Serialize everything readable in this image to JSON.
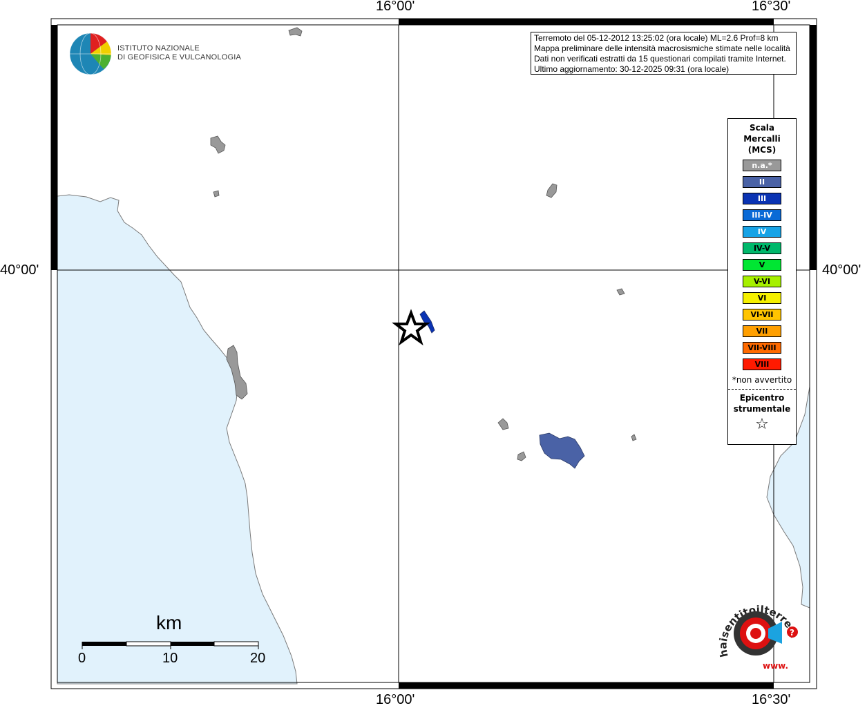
{
  "coords": {
    "top_lon_1": "16°00'",
    "top_lon_2": "16°30'",
    "bottom_lon_1": "16°00'",
    "bottom_lon_2": "16°30'",
    "left_lat": "40°00'",
    "right_lat": "40°00'"
  },
  "logo": {
    "line1": "ISTITUTO NAZIONALE",
    "line2": "DI GEOFISICA E VULCANOLOGIA"
  },
  "info": {
    "line1": "Terremoto del 05-12-2012 13:25:02 (ora locale) ML=2.6 Prof=8 km",
    "line2": "Mappa preliminare delle intensità macrosismiche stimate nelle località",
    "line3": "Dati non verificati estratti da 15 questionari compilati tramite Internet.",
    "line4": "Ultimo aggiornamento: 30-12-2025 09:31 (ora locale)"
  },
  "legend": {
    "title1": "Scala",
    "title2": "Mercalli",
    "title3": "(MCS)",
    "classes": [
      {
        "label": "n.a.*",
        "color": "#999999",
        "text_color": "#ffffff"
      },
      {
        "label": "II",
        "color": "#4a62a6",
        "text_color": "#ffffff"
      },
      {
        "label": "III",
        "color": "#0a33b3",
        "text_color": "#ffffff"
      },
      {
        "label": "III-IV",
        "color": "#0a6ad6",
        "text_color": "#ffffff"
      },
      {
        "label": "IV",
        "color": "#17a3e6",
        "text_color": "#ffffff"
      },
      {
        "label": "IV-V",
        "color": "#00b86b",
        "text_color": "#000000"
      },
      {
        "label": "V",
        "color": "#00e633",
        "text_color": "#000000"
      },
      {
        "label": "V-VI",
        "color": "#a6f000",
        "text_color": "#000000"
      },
      {
        "label": "VI",
        "color": "#f5f000",
        "text_color": "#000000"
      },
      {
        "label": "VI-VII",
        "color": "#ffc400",
        "text_color": "#000000"
      },
      {
        "label": "VII",
        "color": "#ff9f00",
        "text_color": "#000000"
      },
      {
        "label": "VII-VIII",
        "color": "#ff6a00",
        "text_color": "#000000"
      },
      {
        "label": "VIII",
        "color": "#ff1a00",
        "text_color": "#000000"
      }
    ],
    "note": "*non avvertito",
    "epicentro1": "Epicentro",
    "epicentro2": "strumentale",
    "star": "☆"
  },
  "scale_bar": {
    "unit": "km",
    "labels": [
      "0",
      "10",
      "20"
    ]
  },
  "colors": {
    "sea": "#e1f2fc",
    "land": "#ffffff",
    "locality_na": "#999999",
    "locality_ii": "#4a62a6",
    "locality_iii": "#0a33b3"
  },
  "badge": {
    "text_arc": "haisentitoilterremoto.it",
    "www": "www."
  }
}
